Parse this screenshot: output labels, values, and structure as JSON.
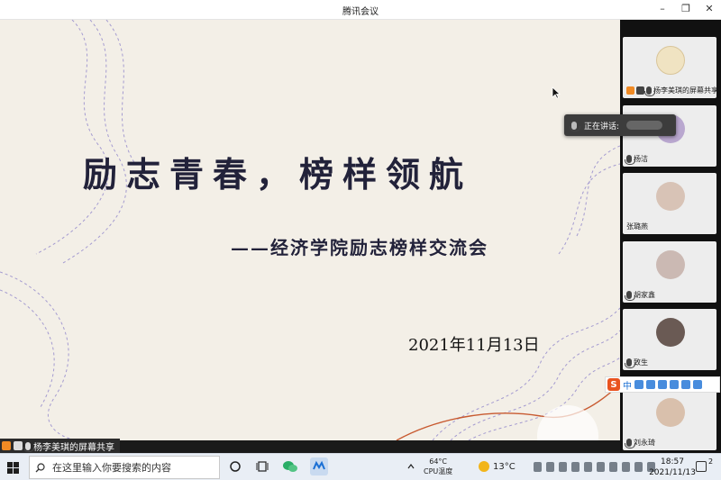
{
  "window": {
    "title": "腾讯会议"
  },
  "slide": {
    "title": "励志青春，榜样领航",
    "subtitle": "——经济学院励志榜样交流会",
    "date": "2021年11月13日"
  },
  "share_label": "杨李美琪的屏幕共享",
  "speaking": {
    "label": "正在讲话:"
  },
  "participants": [
    {
      "name": "杨李美琪的屏幕共享",
      "avatar_color": "#f0e3c2"
    },
    {
      "name": "杨洁",
      "avatar_color": "#b9a7cf"
    },
    {
      "name": "张璐燕",
      "avatar_color": "#d8c3b6"
    },
    {
      "name": "胡家鑫",
      "avatar_color": "#cbb9b3"
    },
    {
      "name": "致生",
      "avatar_color": "#6a5a54"
    },
    {
      "name": "刘永琦",
      "avatar_color": "#d9c0ac"
    }
  ],
  "ime": {
    "lang": "中"
  },
  "taskbar": {
    "search_placeholder": "在这里输入你要搜索的内容",
    "cpu_temp": "64°C",
    "cpu_label": "CPU温度",
    "weather_temp": "13°C",
    "time": "18:57",
    "date": "2021/11/13",
    "notif_count": "2"
  },
  "colors": {
    "slide_bg": "#f3efe7",
    "accent_line": "#c85a30",
    "dash_line": "#8a7fc9"
  }
}
